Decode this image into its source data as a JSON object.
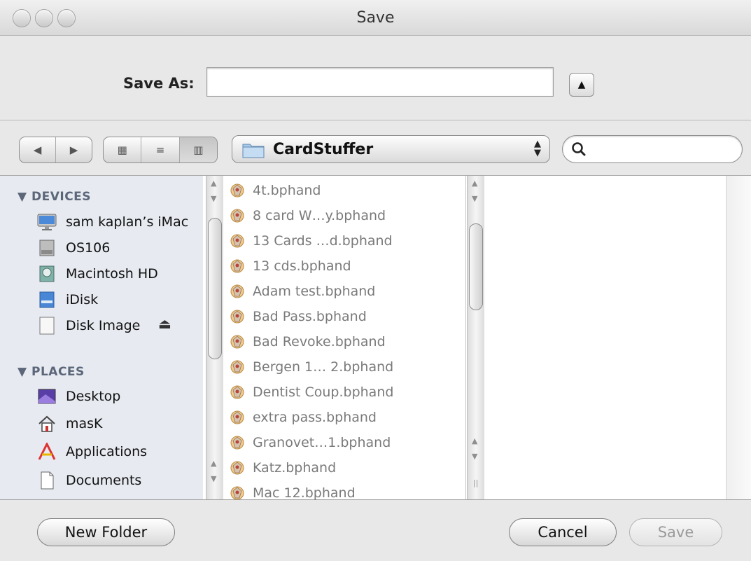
{
  "window": {
    "title": "Save"
  },
  "save_as": {
    "label": "Save As:",
    "value": "",
    "expand_icon": "▲"
  },
  "toolbar": {
    "back_icon": "◀",
    "forward_icon": "▶",
    "view_icons": [
      "▦",
      "≡",
      "▥"
    ],
    "location": "CardStuffer",
    "location_arrows": "▲\n▼",
    "search_placeholder": ""
  },
  "sidebar": {
    "devices_header": "▼ DEVICES",
    "devices": [
      {
        "label": "sam kaplan’s iMac",
        "icon": "imac-icon"
      },
      {
        "label": "OS106",
        "icon": "hard-drive-icon"
      },
      {
        "label": "Macintosh HD",
        "icon": "hard-drive-icon"
      },
      {
        "label": "iDisk",
        "icon": "idisk-icon"
      },
      {
        "label": "Disk Image",
        "icon": "disk-image-icon"
      }
    ],
    "eject_icon": "⏏",
    "places_header": "▼ PLACES",
    "places": [
      {
        "label": "Desktop",
        "icon": "desktop-icon"
      },
      {
        "label": "masK",
        "icon": "home-icon"
      },
      {
        "label": "Applications",
        "icon": "applications-icon"
      },
      {
        "label": "Documents",
        "icon": "documents-icon"
      }
    ]
  },
  "files": [
    "4t.bphand",
    "8 card W…y.bphand",
    "13 Cards …d.bphand",
    "13 cds.bphand",
    "Adam test.bphand",
    "Bad Pass.bphand",
    "Bad Revoke.bphand",
    "Bergen 1… 2.bphand",
    "Dentist Coup.bphand",
    "extra pass.bphand",
    "Granovet…1.bphand",
    "Katz.bphand",
    "Mac 12.bphand"
  ],
  "buttons": {
    "new_folder": "New Folder",
    "cancel": "Cancel",
    "save": "Save"
  },
  "colors": {
    "sidebar_bg": "#e7ebf1",
    "sidebar_header": "#5b6679",
    "file_text": "#7a7a7a"
  }
}
